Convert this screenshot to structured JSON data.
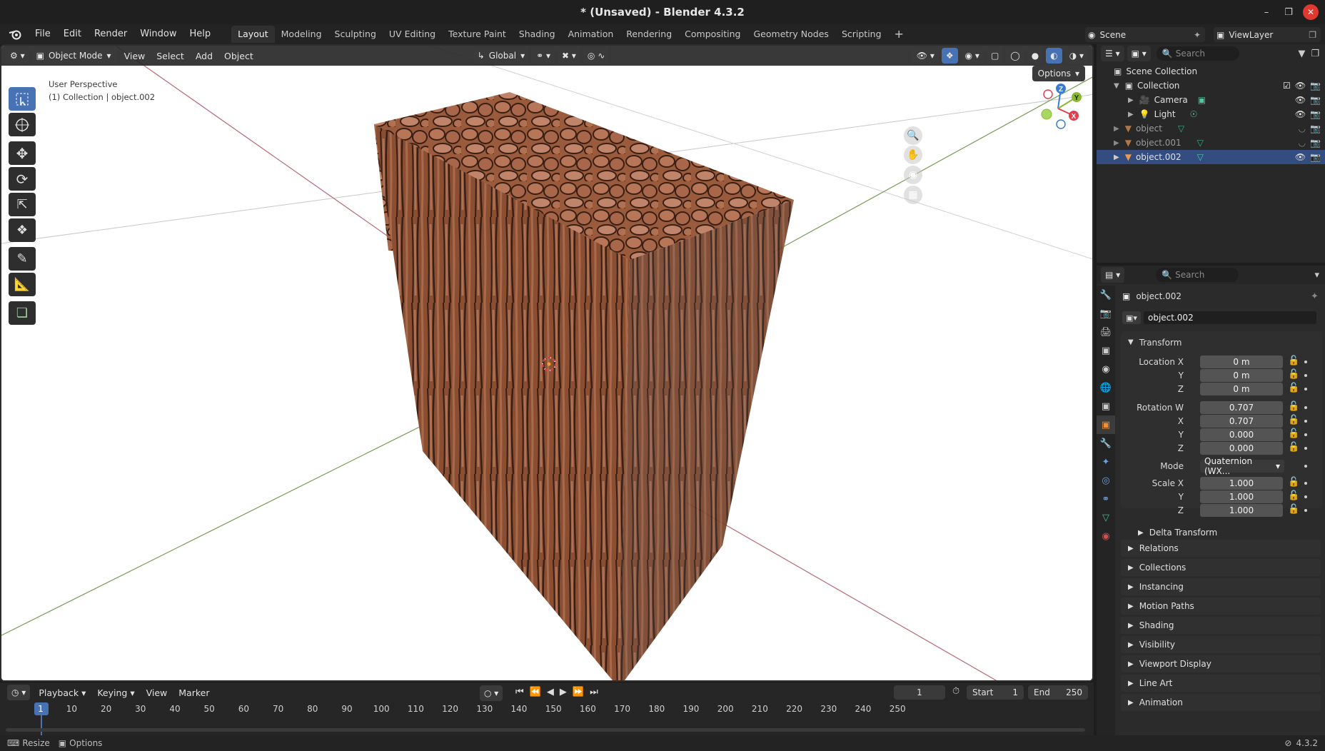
{
  "window": {
    "title": "* (Unsaved) - Blender 4.3.2"
  },
  "menu": {
    "file": "File",
    "edit": "Edit",
    "render": "Render",
    "window": "Window",
    "help": "Help"
  },
  "workspaces": [
    "Layout",
    "Modeling",
    "Sculpting",
    "UV Editing",
    "Texture Paint",
    "Shading",
    "Animation",
    "Rendering",
    "Compositing",
    "Geometry Nodes",
    "Scripting"
  ],
  "active_workspace": "Layout",
  "scene": {
    "scene_name": "Scene",
    "view_layer": "ViewLayer"
  },
  "viewport": {
    "mode": "Object Mode",
    "menus": [
      "View",
      "Select",
      "Add",
      "Object"
    ],
    "orientation": "Global",
    "options_label": "Options",
    "perspective_label": "User Perspective",
    "collection_label": "(1) Collection | object.002",
    "gizmo_axes": [
      "Z",
      "Y",
      "X"
    ]
  },
  "timeline": {
    "menus": [
      "Playback",
      "Keying",
      "View",
      "Marker"
    ],
    "current_frame": "1",
    "start_label": "Start",
    "start_value": "1",
    "end_label": "End",
    "end_value": "250",
    "ruler": [
      "1",
      "10",
      "20",
      "30",
      "40",
      "50",
      "60",
      "70",
      "80",
      "90",
      "100",
      "110",
      "120",
      "130",
      "140",
      "150",
      "160",
      "170",
      "180",
      "190",
      "200",
      "210",
      "220",
      "230",
      "240",
      "250"
    ]
  },
  "status": {
    "resize": "Resize",
    "options": "Options",
    "version": "4.3.2"
  },
  "outliner": {
    "search_placeholder": "Search",
    "scene_collection": "Scene Collection",
    "collection": "Collection",
    "items": [
      {
        "name": "Camera"
      },
      {
        "name": "Light"
      },
      {
        "name": "object"
      },
      {
        "name": "object.001"
      },
      {
        "name": "object.002"
      }
    ]
  },
  "properties": {
    "search_placeholder": "Search",
    "object_name": "object.002",
    "object_field": "object.002",
    "transform_title": "Transform",
    "location_label": "Location X",
    "location": [
      "0 m",
      "0 m",
      "0 m"
    ],
    "rotation_label": "Rotation W",
    "rotation": [
      "0.707",
      "0.707",
      "0.000",
      "0.000"
    ],
    "mode_label": "Mode",
    "mode_value": "Quaternion (WX...",
    "scale_label": "Scale X",
    "scale": [
      "1.000",
      "1.000",
      "1.000"
    ],
    "axis_y": "Y",
    "axis_x": "X",
    "axis_z": "Z",
    "delta_transform": "Delta Transform",
    "sections": [
      "Relations",
      "Collections",
      "Instancing",
      "Motion Paths",
      "Shading",
      "Visibility",
      "Viewport Display",
      "Line Art",
      "Animation"
    ]
  },
  "colors": {
    "accent": "#4772b3",
    "selected_row": "#334d80",
    "close_button": "#e0392f"
  }
}
